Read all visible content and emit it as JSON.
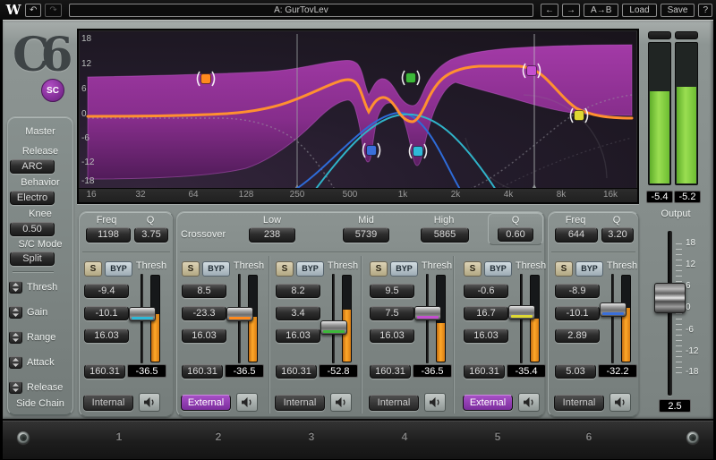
{
  "titlebar": {
    "logo": "W",
    "undo_icon": "↶",
    "redo_icon": "↷",
    "preset": "A: GurTovLev",
    "prev_icon": "←",
    "next_icon": "→",
    "ab": "A→B",
    "load": "Load",
    "save": "Save",
    "help": "?"
  },
  "sidebar": {
    "logo_text": "C6",
    "logo_badge": "SC",
    "master_label": "Master",
    "release_label": "Release",
    "release_value": "ARC",
    "behavior_label": "Behavior",
    "behavior_value": "Electro",
    "knee_label": "Knee",
    "knee_value": "0.50",
    "sc_mode_label": "S/C Mode",
    "sc_mode_value": "Split",
    "link_rows": [
      "Thresh",
      "Gain",
      "Range",
      "Attack",
      "Release"
    ],
    "side_chain_label": "Side Chain"
  },
  "graph": {
    "y_ticks": [
      "18",
      "12",
      "6",
      "0",
      "-6",
      "-12",
      "-18"
    ],
    "x_ticks": [
      "16",
      "32",
      "64",
      "128",
      "250",
      "500",
      "1k",
      "2k",
      "4k",
      "8k",
      "16k"
    ],
    "curve_color": "#ff9030",
    "region_color": "#8f2f94"
  },
  "meters": {
    "left_value": "-5.4",
    "right_value": "-5.2",
    "fill_color": "#7ed23e"
  },
  "output": {
    "label": "Output",
    "scale": [
      "18",
      "12",
      "6",
      "0",
      "-6",
      "-12",
      "-18"
    ],
    "value": "2.5"
  },
  "band1_eq": {
    "freq_label": "Freq",
    "q_label": "Q",
    "freq": "1198",
    "q": "3.75"
  },
  "crossover": {
    "label": "Crossover",
    "low_label": "Low",
    "low": "238",
    "mid_label": "Mid",
    "mid": "5739",
    "high_label": "High",
    "high": "5865",
    "q_label": "Q",
    "q": "0.60"
  },
  "band6_eq": {
    "freq_label": "Freq",
    "q_label": "Q",
    "freq": "644",
    "q": "3.20"
  },
  "bands": [
    {
      "number": "1",
      "solo": "S",
      "bypass": "BYP",
      "thresh_label": "Thresh",
      "gain": "-9.4",
      "range": "-10.1",
      "attack": "16.03",
      "release": "160.31",
      "thresh": "-36.5",
      "route": "Internal",
      "color": "#2eb9d8"
    },
    {
      "number": "2",
      "solo": "S",
      "bypass": "BYP",
      "thresh_label": "Thresh",
      "gain": "8.5",
      "range": "-23.3",
      "attack": "16.03",
      "release": "160.31",
      "thresh": "-36.5",
      "route": "External",
      "color": "#ff8a1e"
    },
    {
      "number": "3",
      "solo": "S",
      "bypass": "BYP",
      "thresh_label": "Thresh",
      "gain": "8.2",
      "range": "3.4",
      "attack": "16.03",
      "release": "160.31",
      "thresh": "-52.8",
      "route": "Internal",
      "color": "#3db83a"
    },
    {
      "number": "4",
      "solo": "S",
      "bypass": "BYP",
      "thresh_label": "Thresh",
      "gain": "9.5",
      "range": "7.5",
      "attack": "16.03",
      "release": "160.31",
      "thresh": "-36.5",
      "route": "Internal",
      "color": "#c44fd0"
    },
    {
      "number": "5",
      "solo": "S",
      "bypass": "BYP",
      "thresh_label": "Thresh",
      "gain": "-0.6",
      "range": "16.7",
      "attack": "16.03",
      "release": "160.31",
      "thresh": "-35.4",
      "route": "External",
      "color": "#ded832"
    },
    {
      "number": "6",
      "solo": "S",
      "bypass": "BYP",
      "thresh_label": "Thresh",
      "gain": "-8.9",
      "range": "-10.1",
      "attack": "2.89",
      "release": "5.03",
      "thresh": "-32.2",
      "route": "Internal",
      "color": "#3a6fd9"
    }
  ],
  "footer": {
    "numbers": [
      "1",
      "2",
      "3",
      "4",
      "5",
      "6"
    ]
  }
}
